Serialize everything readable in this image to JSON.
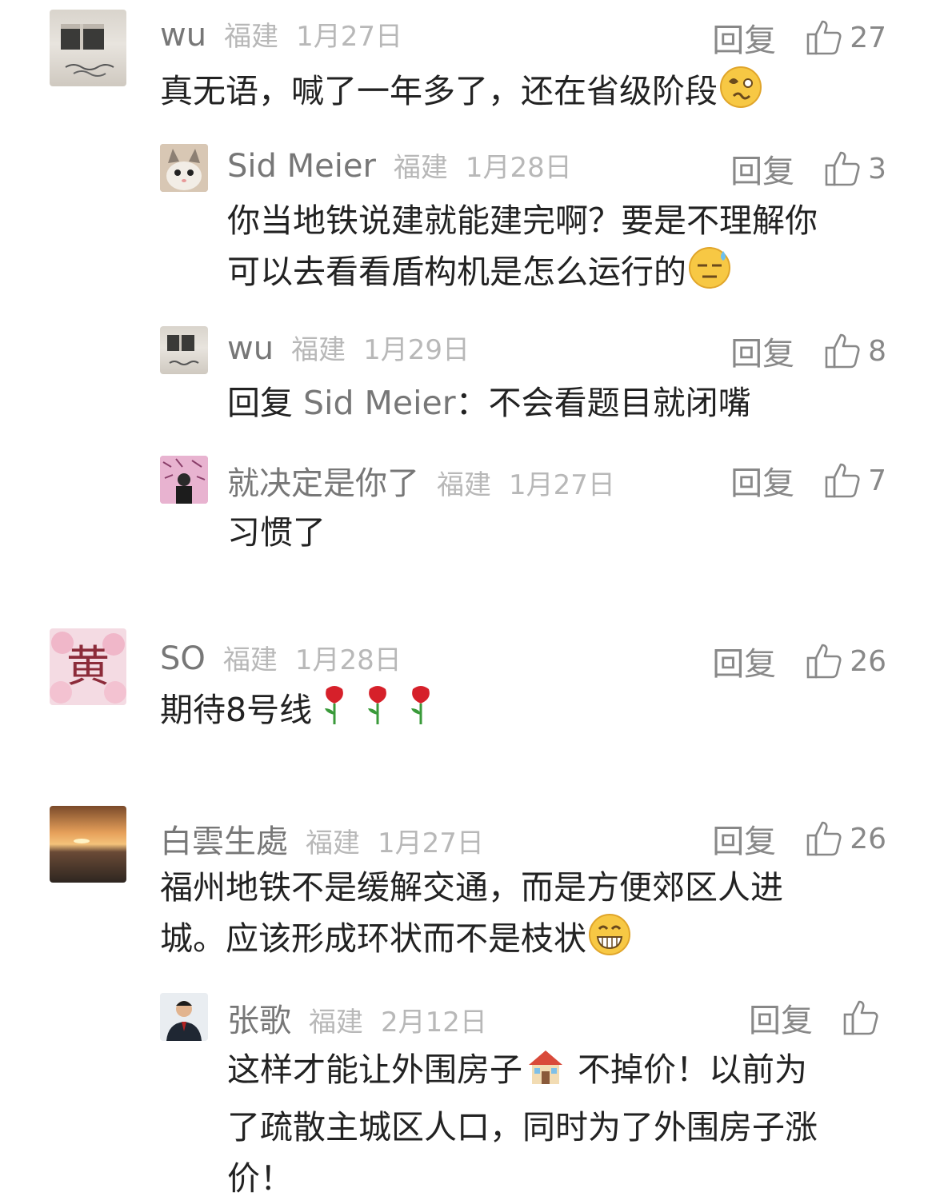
{
  "colors": {
    "name": "#777777",
    "meta": "#b8b8b8",
    "action": "#888888",
    "text": "#222222"
  },
  "comments": [
    {
      "name": "wu",
      "location": "福建",
      "date": "1月27日",
      "reply": "回复",
      "likes": "27",
      "lines": [
        "真无语，喊了一年多了，还在省级阶段"
      ],
      "emoji": "woozy-face",
      "replies": [
        {
          "name": "Sid Meier",
          "location": "福建",
          "date": "1月28日",
          "reply": "回复",
          "likes": "3",
          "lines": [
            "你当地铁说建就能建完啊？要是不理解你",
            "可以去看看盾构机是怎么运行的"
          ],
          "emoji": "sweat-face"
        },
        {
          "name": "wu",
          "location": "福建",
          "date": "1月29日",
          "reply": "回复",
          "likes": "8",
          "reply_prefix": "回复 ",
          "reply_target": "Sid Meier",
          "lines": [
            "：不会看题目就闭嘴"
          ]
        },
        {
          "name": "就决定是你了",
          "location": "福建",
          "date": "1月27日",
          "reply": "回复",
          "likes": "7",
          "lines": [
            "习惯了"
          ]
        }
      ]
    },
    {
      "name": "SO",
      "location": "福建",
      "date": "1月28日",
      "reply": "回复",
      "likes": "26",
      "lines": [
        "期待8号线"
      ],
      "emoji": "rose-icon"
    },
    {
      "name": "白雲生處",
      "location": "福建",
      "date": "1月27日",
      "reply": "回复",
      "likes": "26",
      "lines": [
        "福州地铁不是缓解交通，而是方便郊区人进",
        "城。应该形成环状而不是枝状"
      ],
      "emoji": "grin-face",
      "replies": [
        {
          "name": "张歌",
          "location": "福建",
          "date": "2月12日",
          "reply": "回复",
          "likes": "",
          "lines": [
            "这样才能让外围房子",
            " 不掉价！以前为",
            "了疏散主城区人口，同时为了外围房子涨",
            "价！"
          ],
          "emoji": "house-icon"
        }
      ]
    }
  ]
}
